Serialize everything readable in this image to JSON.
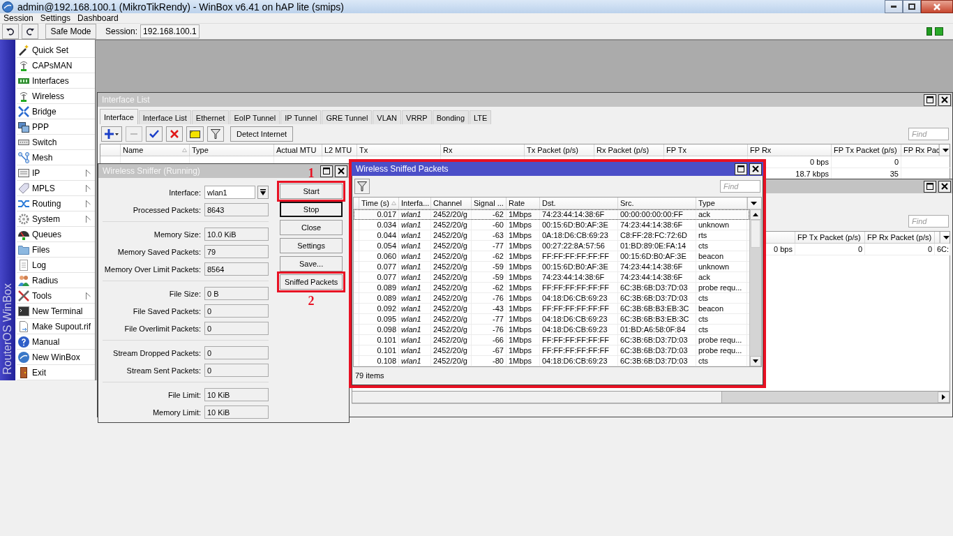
{
  "window": {
    "title": "admin@192.168.100.1 (MikroTikRendy) - WinBox v6.41 on hAP lite (smips)"
  },
  "menu": [
    "Session",
    "Settings",
    "Dashboard"
  ],
  "toolbar": {
    "safe_mode": "Safe Mode",
    "session_label": "Session:",
    "session_value": "192.168.100.1"
  },
  "sidebar": {
    "brand": "RouterOS WinBox",
    "items": [
      {
        "label": "Quick Set",
        "submenu": false
      },
      {
        "label": "CAPsMAN",
        "submenu": false
      },
      {
        "label": "Interfaces",
        "submenu": false
      },
      {
        "label": "Wireless",
        "submenu": false
      },
      {
        "label": "Bridge",
        "submenu": false
      },
      {
        "label": "PPP",
        "submenu": false
      },
      {
        "label": "Switch",
        "submenu": false
      },
      {
        "label": "Mesh",
        "submenu": false
      },
      {
        "label": "IP",
        "submenu": true
      },
      {
        "label": "MPLS",
        "submenu": true
      },
      {
        "label": "Routing",
        "submenu": true
      },
      {
        "label": "System",
        "submenu": true
      },
      {
        "label": "Queues",
        "submenu": false
      },
      {
        "label": "Files",
        "submenu": false
      },
      {
        "label": "Log",
        "submenu": false
      },
      {
        "label": "Radius",
        "submenu": false
      },
      {
        "label": "Tools",
        "submenu": true
      },
      {
        "label": "New Terminal",
        "submenu": false
      },
      {
        "label": "Make Supout.rif",
        "submenu": false
      },
      {
        "label": "Manual",
        "submenu": false
      },
      {
        "label": "New WinBox",
        "submenu": false
      },
      {
        "label": "Exit",
        "submenu": false
      }
    ]
  },
  "interface_list": {
    "title": "Interface List",
    "active": false,
    "kind": "plain",
    "tabs": [
      {
        "label": "Interface",
        "selected": true
      },
      {
        "label": "Interface List",
        "selected": false
      },
      {
        "label": "Ethernet",
        "selected": false
      },
      {
        "label": "EoIP Tunnel",
        "selected": false
      },
      {
        "label": "IP Tunnel",
        "selected": false
      },
      {
        "label": "GRE Tunnel",
        "selected": false
      },
      {
        "label": "VLAN",
        "selected": false
      },
      {
        "label": "VRRP",
        "selected": false
      },
      {
        "label": "Bonding",
        "selected": false
      },
      {
        "label": "LTE",
        "selected": false
      }
    ],
    "toolbar": [
      {
        "kind": "add",
        "disabled": false
      },
      {
        "kind": "remove",
        "disabled": true
      },
      {
        "kind": "enable",
        "disabled": false
      },
      {
        "kind": "disable",
        "disabled": false
      },
      {
        "kind": "comment",
        "disabled": false
      },
      {
        "kind": "filter",
        "disabled": false
      },
      {
        "kind": "text",
        "label": "Detect Internet",
        "disabled": false
      }
    ],
    "find_placeholder": "Find",
    "columns": [
      "Name",
      "Type",
      "Actual MTU",
      "L2 MTU",
      "Tx",
      "Rx",
      "Tx Packet (p/s)",
      "Rx Packet (p/s)",
      "FP Tx",
      "FP Rx",
      "FP Tx Packet (p/s)",
      "FP Rx Pac"
    ],
    "rows": [
      [
        "0 bps",
        "0"
      ],
      [
        "18.7 kbps",
        "35"
      ]
    ]
  },
  "background_window": {
    "active": false,
    "kind": "plain",
    "find_placeholder": "Find",
    "columns": [
      "",
      "FP Tx Packet (p/s)",
      "FP Rx Packet (p/s)"
    ],
    "rows": [
      [
        "0 bps",
        "0",
        "0",
        "6C:"
      ]
    ]
  },
  "sniffer": {
    "title": "Wireless Sniffer (Running)",
    "active": false,
    "kind": "plain",
    "groups": [
      {
        "fields": [
          {
            "label": "Interface:",
            "value": "wlan1",
            "kind": "dropdown"
          },
          {
            "label": "Processed Packets:",
            "value": "8643",
            "kind": "readonly"
          }
        ]
      },
      {
        "fields": [
          {
            "label": "Memory Size:",
            "value": "10.0 KiB",
            "kind": "readonly"
          },
          {
            "label": "Memory Saved Packets:",
            "value": "79",
            "kind": "readonly"
          },
          {
            "label": "Memory Over Limit Packets:",
            "value": "8564",
            "kind": "readonly"
          }
        ]
      },
      {
        "fields": [
          {
            "label": "File Size:",
            "value": "0 B",
            "kind": "readonly"
          },
          {
            "label": "File Saved Packets:",
            "value": "0",
            "kind": "readonly"
          },
          {
            "label": "File Overlimit Packets:",
            "value": "0",
            "kind": "readonly"
          }
        ]
      },
      {
        "fields": [
          {
            "label": "Stream Dropped Packets:",
            "value": "0",
            "kind": "readonly"
          },
          {
            "label": "Stream Sent Packets:",
            "value": "0",
            "kind": "readonly"
          }
        ]
      },
      {
        "fields": [
          {
            "label": "File Limit:",
            "value": "10 KiB",
            "kind": "readonly"
          },
          {
            "label": "Memory Limit:",
            "value": "10 KiB",
            "kind": "readonly"
          }
        ]
      }
    ],
    "buttons": [
      {
        "label": "Start",
        "kind": "highlighted",
        "default": false,
        "annotation_above": "1"
      },
      {
        "label": "Stop",
        "kind": "plain",
        "default": true
      },
      {
        "label": "Close",
        "kind": "plain",
        "default": false
      },
      {
        "label": "Settings",
        "kind": "plain",
        "default": false
      },
      {
        "label": "Save...",
        "kind": "plain",
        "default": false
      },
      {
        "label": "Sniffed Packets",
        "kind": "highlighted",
        "default": false,
        "annotation_below": "2"
      }
    ]
  },
  "sniffed_packets": {
    "title": "Wireless Sniffed Packets",
    "active": true,
    "kind": "highlighted",
    "find_placeholder": "Find",
    "columns": [
      "Time (s)",
      "Interfa...",
      "Channel",
      "Signal ...",
      "Rate",
      "Dst.",
      "Src.",
      "Type"
    ],
    "rows": [
      {
        "cells": [
          "0.017",
          "wlan1",
          "2452/20/g",
          "-62",
          "1Mbps",
          "74:23:44:14:38:6F",
          "00:00:00:00:00:FF",
          "ack"
        ],
        "focused": true
      },
      {
        "cells": [
          "0.034",
          "wlan1",
          "2452/20/g",
          "-60",
          "1Mbps",
          "00:15:6D:B0:AF:3E",
          "74:23:44:14:38:6F",
          "unknown"
        ],
        "focused": false
      },
      {
        "cells": [
          "0.044",
          "wlan1",
          "2452/20/g",
          "-63",
          "1Mbps",
          "0A:18:D6:CB:69:23",
          "C8:FF:28:FC:72:6D",
          "rts"
        ],
        "focused": false
      },
      {
        "cells": [
          "0.054",
          "wlan1",
          "2452/20/g",
          "-77",
          "1Mbps",
          "00:27:22:8A:57:56",
          "01:BD:89:0E:FA:14",
          "cts"
        ],
        "focused": false
      },
      {
        "cells": [
          "0.060",
          "wlan1",
          "2452/20/g",
          "-62",
          "1Mbps",
          "FF:FF:FF:FF:FF:FF",
          "00:15:6D:B0:AF:3E",
          "beacon"
        ],
        "focused": false
      },
      {
        "cells": [
          "0.077",
          "wlan1",
          "2452/20/g",
          "-59",
          "1Mbps",
          "00:15:6D:B0:AF:3E",
          "74:23:44:14:38:6F",
          "unknown"
        ],
        "focused": false
      },
      {
        "cells": [
          "0.077",
          "wlan1",
          "2452/20/g",
          "-59",
          "1Mbps",
          "74:23:44:14:38:6F",
          "74:23:44:14:38:6F",
          "ack"
        ],
        "focused": false
      },
      {
        "cells": [
          "0.089",
          "wlan1",
          "2452/20/g",
          "-62",
          "1Mbps",
          "FF:FF:FF:FF:FF:FF",
          "6C:3B:6B:D3:7D:03",
          "probe requ..."
        ],
        "focused": false
      },
      {
        "cells": [
          "0.089",
          "wlan1",
          "2452/20/g",
          "-76",
          "1Mbps",
          "04:18:D6:CB:69:23",
          "6C:3B:6B:D3:7D:03",
          "cts"
        ],
        "focused": false
      },
      {
        "cells": [
          "0.092",
          "wlan1",
          "2452/20/g",
          "-43",
          "1Mbps",
          "FF:FF:FF:FF:FF:FF",
          "6C:3B:6B:B3:EB:3C",
          "beacon"
        ],
        "focused": false
      },
      {
        "cells": [
          "0.095",
          "wlan1",
          "2452/20/g",
          "-77",
          "1Mbps",
          "04:18:D6:CB:69:23",
          "6C:3B:6B:B3:EB:3C",
          "cts"
        ],
        "focused": false
      },
      {
        "cells": [
          "0.098",
          "wlan1",
          "2452/20/g",
          "-76",
          "1Mbps",
          "04:18:D6:CB:69:23",
          "01:BD:A6:58:0F:84",
          "cts"
        ],
        "focused": false
      },
      {
        "cells": [
          "0.101",
          "wlan1",
          "2452/20/g",
          "-66",
          "1Mbps",
          "FF:FF:FF:FF:FF:FF",
          "6C:3B:6B:D3:7D:03",
          "probe requ..."
        ],
        "focused": false
      },
      {
        "cells": [
          "0.101",
          "wlan1",
          "2452/20/g",
          "-67",
          "1Mbps",
          "FF:FF:FF:FF:FF:FF",
          "6C:3B:6B:D3:7D:03",
          "probe requ..."
        ],
        "focused": false
      },
      {
        "cells": [
          "0.108",
          "wlan1",
          "2452/20/g",
          "-80",
          "1Mbps",
          "04:18:D6:CB:69:23",
          "6C:3B:6B:D3:7D:03",
          "cts"
        ],
        "focused": false
      }
    ],
    "status": "79 items"
  }
}
